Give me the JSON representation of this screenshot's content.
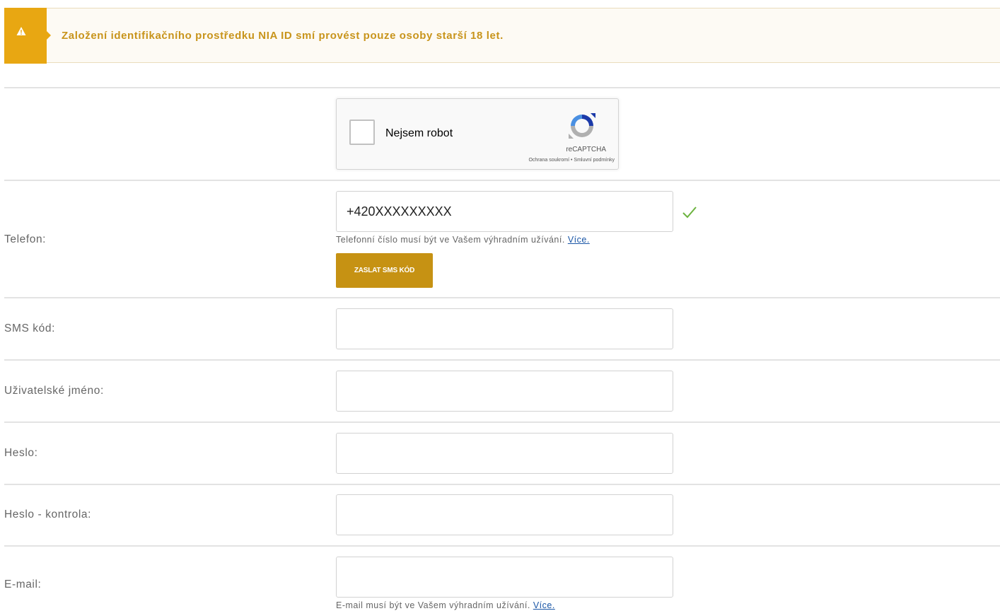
{
  "warning": {
    "text": "Založení identifikačního prostředku NIA ID smí provést pouze osoby starší 18 let.",
    "icon": "warning-icon",
    "color": "#e8a712"
  },
  "recaptcha": {
    "label": "Nejsem robot",
    "brand": "reCAPTCHA",
    "privacy": "Ochrana soukromí",
    "separator": " • ",
    "terms": "Smluvní podmínky"
  },
  "phone": {
    "label": "Telefon:",
    "value": "+420XXXXXXXXX",
    "hint": "Telefonní číslo musí být ve Vašem výhradním užívání.",
    "hint_link": "Více.",
    "button": "ZASLAT SMS KÓD",
    "valid_icon": "checkmark-icon"
  },
  "sms_code": {
    "label": "SMS kód:",
    "value": ""
  },
  "username": {
    "label": "Uživatelské jméno:",
    "value": ""
  },
  "password": {
    "label": "Heslo:",
    "value": ""
  },
  "password_confirm": {
    "label": "Heslo - kontrola:",
    "value": ""
  },
  "email": {
    "label": "E-mail:",
    "value": "",
    "hint": "E-mail musí být ve Vašem výhradním užívání.",
    "hint_link": "Více."
  },
  "colors": {
    "accent": "#c69213",
    "link": "#1a56a6",
    "success": "#6cb33f"
  }
}
